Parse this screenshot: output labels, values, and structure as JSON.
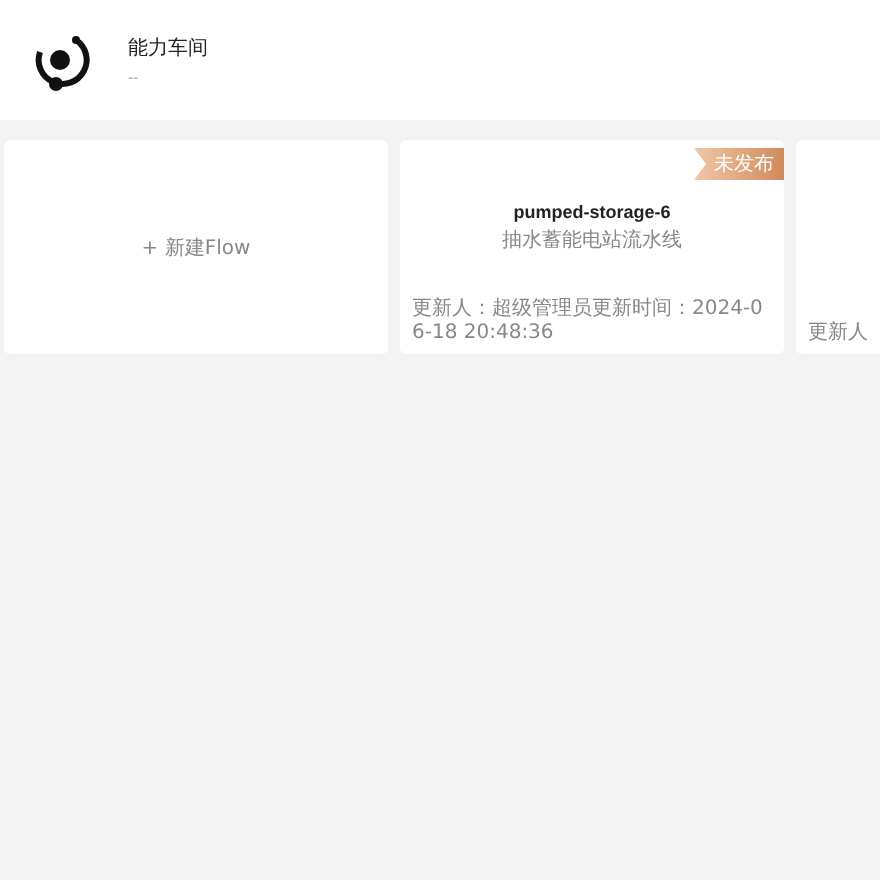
{
  "header": {
    "title": "能力车间",
    "subtitle": "--"
  },
  "new_card": {
    "label": "+ 新建Flow"
  },
  "flows": [
    {
      "name": "pumped-storage-6",
      "description": "抽水蓄能电站流水线",
      "badge": "未发布",
      "footer": "更新人：超级管理员更新时间：2024-06-18 20:48:36"
    },
    {
      "footer": "更新人"
    }
  ]
}
